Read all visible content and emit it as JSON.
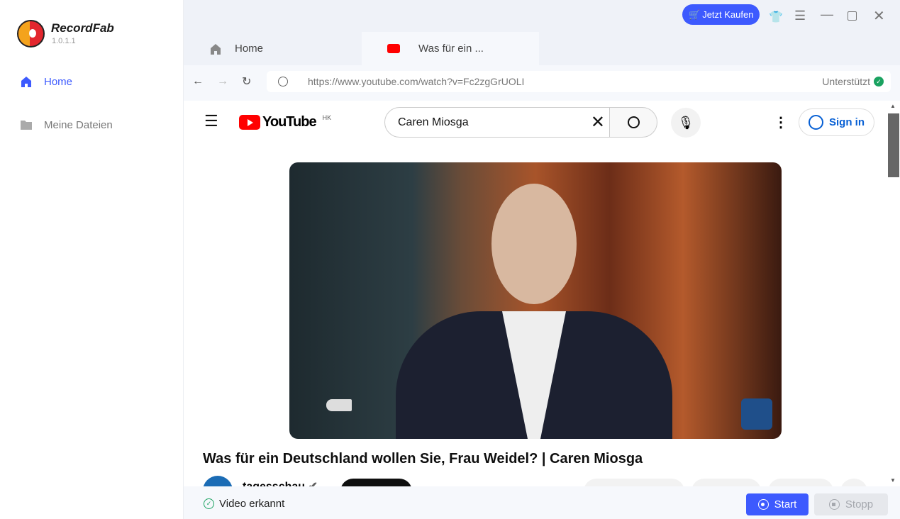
{
  "app": {
    "name": "RecordFab",
    "version": "1.0.1.1",
    "buy_label": "Jetzt Kaufen",
    "accent": "#3d5afe"
  },
  "sidebar": {
    "items": [
      {
        "label": "Home",
        "active": true,
        "icon": "home-icon"
      },
      {
        "label": "Meine Dateien",
        "icon": "folder-icon"
      }
    ]
  },
  "tabs": [
    {
      "label": "Home",
      "icon": "home-icon"
    },
    {
      "label": "Was für ein ...",
      "icon": "youtube-icon",
      "active": true
    }
  ],
  "address": {
    "url": "https://www.youtube.com/watch?v=Fc2zgGrUOLI",
    "status": "Unterstützt"
  },
  "youtube": {
    "logo_text": "YouTube",
    "region": "HK",
    "search_value": "Caren Miosga",
    "sign_in": "Sign in",
    "video_title": "Was für ein Deutschland wollen Sie, Frau Weidel? | Caren Miosga",
    "channel": "tagesschau"
  },
  "footer": {
    "status": "Video erkannt",
    "start": "Start",
    "stop": "Stopp"
  }
}
